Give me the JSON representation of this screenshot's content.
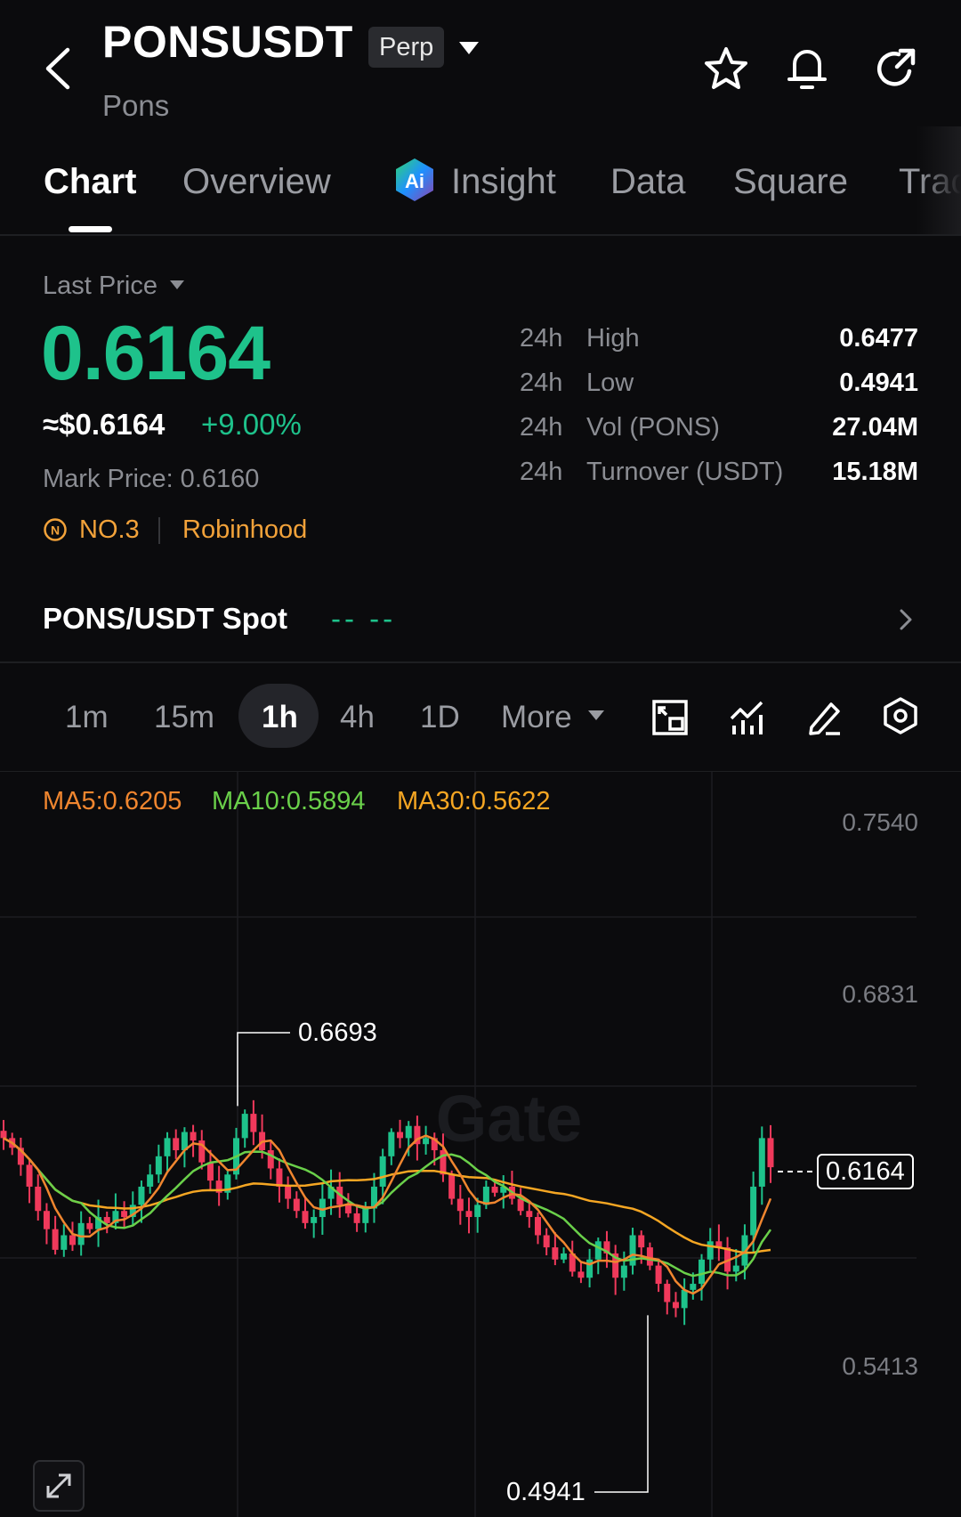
{
  "header": {
    "symbol": "PONSUSDT",
    "contract_badge": "Perp",
    "name": "Pons"
  },
  "tabs": {
    "chart": "Chart",
    "overview": "Overview",
    "insight": "Insight",
    "data": "Data",
    "square": "Square",
    "trade": "Trac"
  },
  "price": {
    "label": "Last Price",
    "last": "0.6164",
    "usd": "≈$0.6164",
    "change": "+9.00%",
    "mark": "Mark Price: 0.6160",
    "rank": "NO.3",
    "tag": "Robinhood"
  },
  "stats": [
    {
      "period": "24h",
      "label": "High",
      "value": "0.6477"
    },
    {
      "period": "24h",
      "label": "Low",
      "value": "0.4941"
    },
    {
      "period": "24h",
      "label": "Vol (PONS)",
      "value": "27.04M"
    },
    {
      "period": "24h",
      "label": "Turnover (USDT)",
      "value": "15.18M"
    }
  ],
  "spot": {
    "label": "PONS/USDT Spot",
    "value": "-- --"
  },
  "intervals": {
    "m1": "1m",
    "m15": "15m",
    "h1": "1h",
    "h4": "4h",
    "d1": "1D",
    "more": "More",
    "selected": "1h"
  },
  "indicators": {
    "ma5": "MA5:0.6205",
    "ma10": "MA10:0.5894",
    "ma30": "MA30:0.5622"
  },
  "chart": {
    "y_labels": [
      "0.7540",
      "0.6831",
      "0.5413"
    ],
    "high_label": "0.6693",
    "low_label": "0.4941",
    "current_tag": "0.6164",
    "watermark": "Gate"
  },
  "colors": {
    "up": "#1ec28b",
    "down": "#f0395b",
    "ma5": "#f0862f",
    "ma10": "#6ad04a",
    "ma30": "#f5a623",
    "accent": "#f2a23a"
  },
  "chart_data": {
    "type": "candlestick",
    "ylim": [
      0.48,
      0.78
    ],
    "y_ticks": [
      0.754,
      0.6831,
      0.5413
    ],
    "last": 0.6164,
    "high_marker": 0.6693,
    "low_marker": 0.4941,
    "ma5_last": 0.6205,
    "ma10_last": 0.5894,
    "ma30_last": 0.5622,
    "closes": [
      0.64,
      0.632,
      0.618,
      0.6,
      0.58,
      0.565,
      0.548,
      0.56,
      0.552,
      0.57,
      0.565,
      0.575,
      0.57,
      0.58,
      0.575,
      0.585,
      0.6,
      0.61,
      0.625,
      0.64,
      0.63,
      0.645,
      0.638,
      0.62,
      0.605,
      0.595,
      0.61,
      0.64,
      0.66,
      0.645,
      0.63,
      0.615,
      0.6,
      0.59,
      0.58,
      0.57,
      0.575,
      0.59,
      0.6,
      0.585,
      0.578,
      0.57,
      0.582,
      0.6,
      0.625,
      0.645,
      0.64,
      0.65,
      0.635,
      0.64,
      0.63,
      0.61,
      0.59,
      0.58,
      0.575,
      0.585,
      0.6,
      0.595,
      0.6,
      0.59,
      0.58,
      0.575,
      0.56,
      0.55,
      0.54,
      0.545,
      0.53,
      0.525,
      0.54,
      0.555,
      0.545,
      0.525,
      0.535,
      0.56,
      0.55,
      0.535,
      0.52,
      0.505,
      0.5,
      0.515,
      0.52,
      0.54,
      0.555,
      0.55,
      0.53,
      0.535,
      0.56,
      0.6,
      0.64,
      0.616
    ]
  }
}
